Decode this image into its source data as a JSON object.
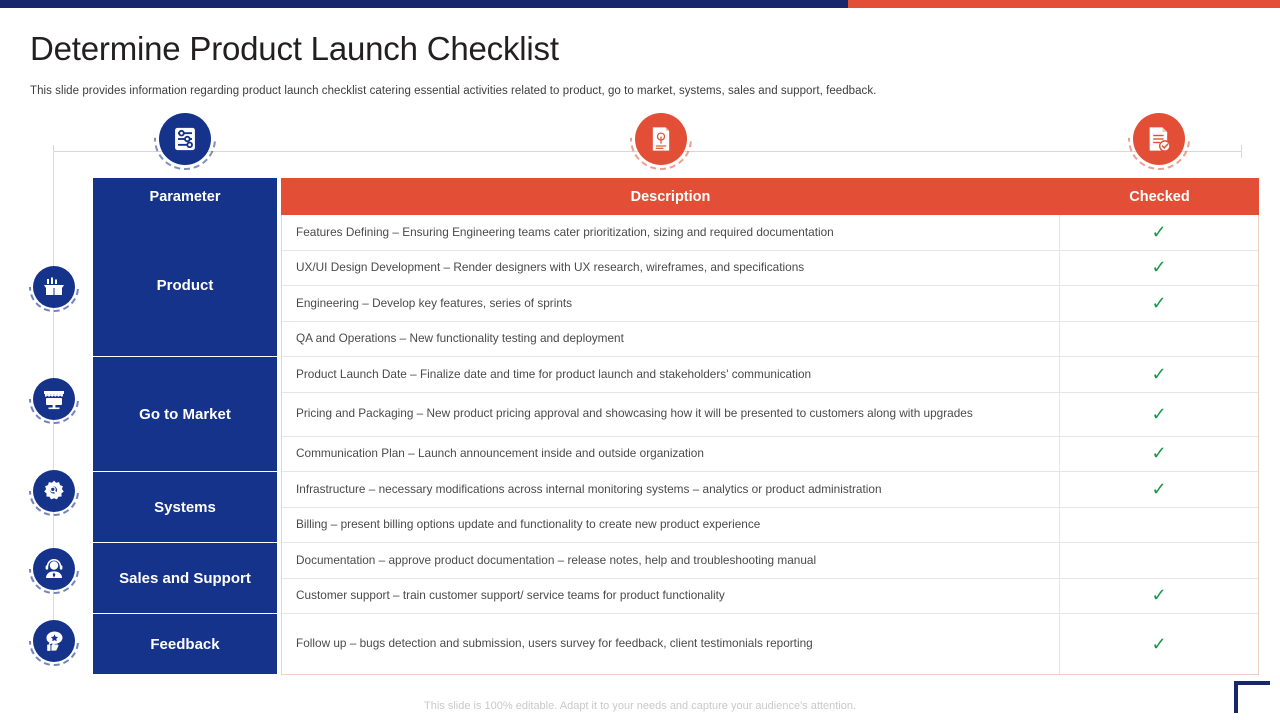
{
  "theme": {
    "navy": "#16338c",
    "orange": "#e24f36",
    "check_green": "#159a4a",
    "topbar_navy": "#16276e"
  },
  "header": {
    "title": "Determine Product Launch Checklist",
    "subtitle": "This slide provides  information  regarding  product launch checklist catering essential activities related to product, go to market, systems, sales and support, feedback."
  },
  "timeline": {
    "nodes": [
      {
        "icon": "sliders-settings-icon",
        "color": "navy"
      },
      {
        "icon": "document-plant-icon",
        "color": "orange"
      },
      {
        "icon": "document-check-icon",
        "color": "orange"
      }
    ]
  },
  "rail": {
    "icons": [
      {
        "icon": "open-box-icon",
        "label": "Product"
      },
      {
        "icon": "market-stall-icon",
        "label": "Go to Market"
      },
      {
        "icon": "gear-search-icon",
        "label": "Systems"
      },
      {
        "icon": "headset-agent-icon",
        "label": "Sales and Support"
      },
      {
        "icon": "thumbs-up-star-icon",
        "label": "Feedback"
      }
    ]
  },
  "table": {
    "columns": {
      "parameter": "Parameter",
      "description": "Description",
      "checked": "Checked"
    },
    "groups": [
      {
        "parameter": "Product",
        "rows": 4
      },
      {
        "parameter": "Go to Market",
        "rows": 3
      },
      {
        "parameter": "Systems",
        "rows": 2
      },
      {
        "parameter": "Sales and Support",
        "rows": 2
      },
      {
        "parameter": "Feedback",
        "rows": 1
      }
    ],
    "rows": [
      {
        "description": "Features Defining – Ensuring Engineering  teams cater prioritization,  sizing and required  documentation",
        "checked": "✓"
      },
      {
        "description": "UX/UI  Design Development   – Render  designers with UX research, wireframes,  and specifications",
        "checked": "✓"
      },
      {
        "description": "Engineering – Develop  key features,  series of sprints",
        "checked": "✓"
      },
      {
        "description": "QA and Operations  – New functionality testing and deployment",
        "checked": ""
      },
      {
        "description": "Product Launch Date – Finalize date and time for product launch and stakeholders' communication",
        "checked": "✓"
      },
      {
        "description": "Pricing and Packaging – New  product pricing approval  and showcasing how it will be presented to customers along with upgrades",
        "checked": "✓"
      },
      {
        "description": "Communication Plan – Launch announcement  inside and outside organization",
        "checked": "✓"
      },
      {
        "description": "Infrastructure  – necessary modifications across internal monitoring systems – analytics or product administration",
        "checked": "✓"
      },
      {
        "description": "Billing – present billing options update and functionality to create new product experience",
        "checked": ""
      },
      {
        "description": "Documentation – approve  product documentation – release notes, help and troubleshooting  manual",
        "checked": ""
      },
      {
        "description": "Customer support – train customer support/ service  teams for product functionality",
        "checked": "✓"
      },
      {
        "description": "Follow up – bugs detection and submission, users survey for feedback,  client testimonials reporting",
        "checked": "✓"
      }
    ]
  },
  "footer": {
    "note": "This slide is 100% editable. Adapt it to your needs and capture your audience's attention."
  }
}
